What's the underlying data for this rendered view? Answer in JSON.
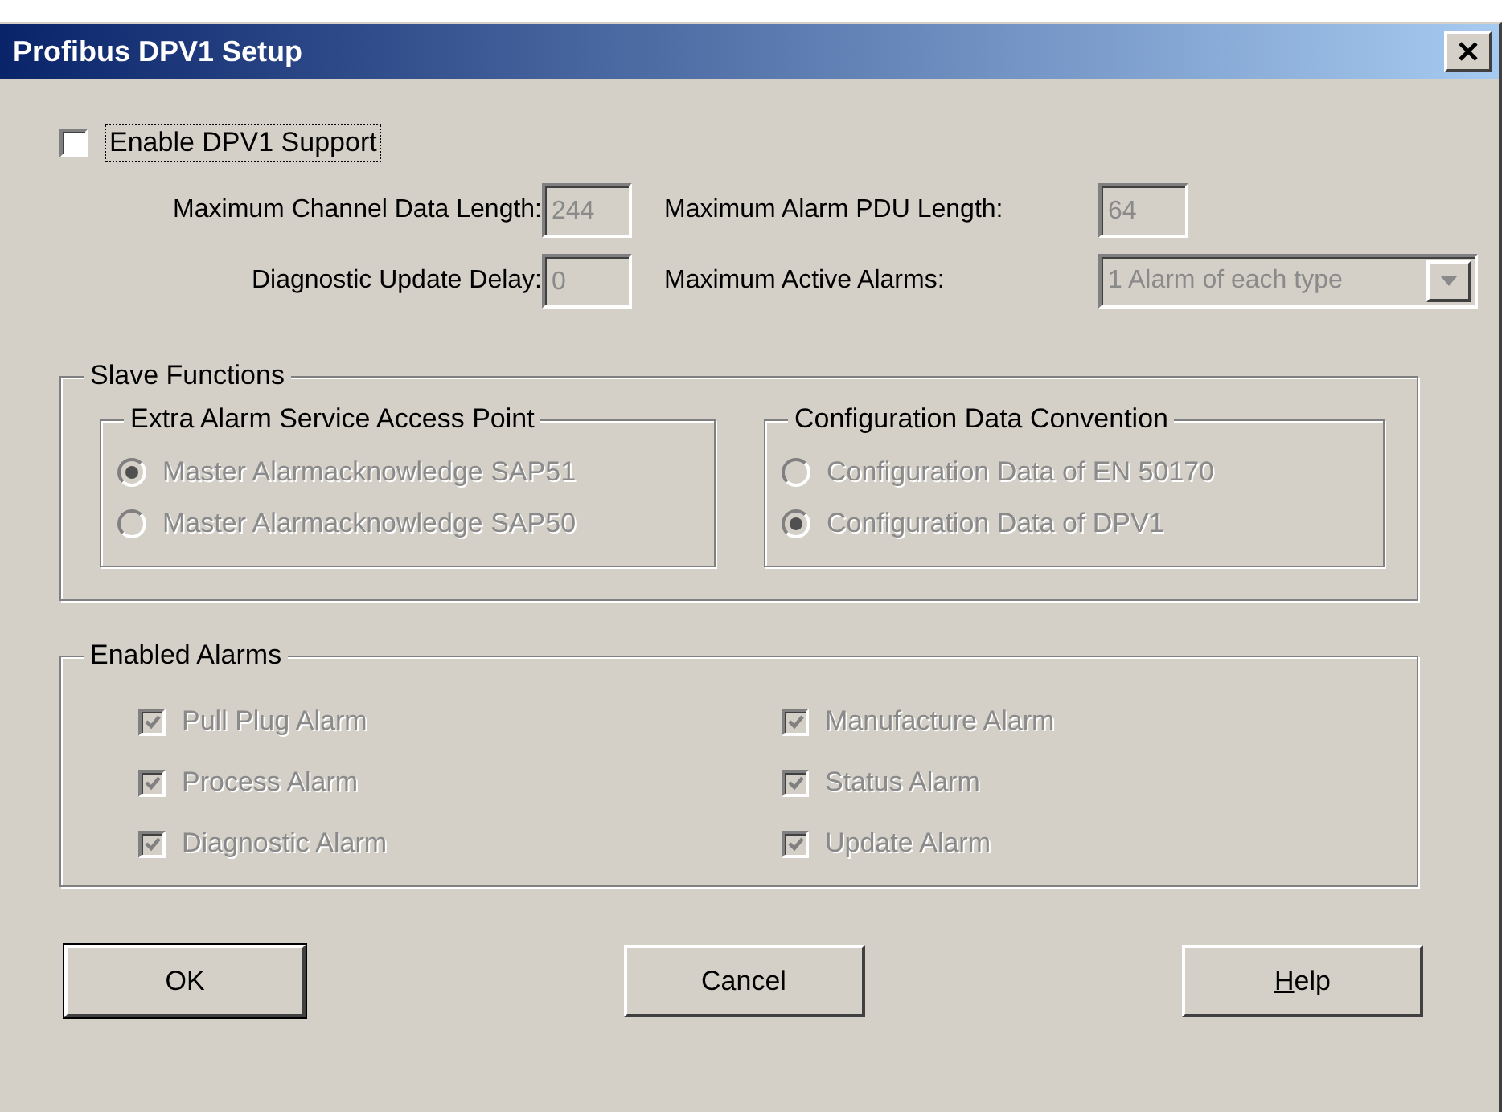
{
  "window": {
    "title": "Profibus DPV1 Setup"
  },
  "enable_checkbox": {
    "label": "Enable DPV1 Support",
    "checked": false
  },
  "fields": [
    {
      "label": "Maximum Channel Data Length:",
      "kind": "text",
      "value": "244",
      "disabled": true
    },
    {
      "label": "Maximum Alarm PDU Length:",
      "kind": "text",
      "value": "64",
      "disabled": true
    },
    {
      "label": "Diagnostic Update Delay:",
      "kind": "text",
      "value": "0",
      "disabled": true
    },
    {
      "label": "Maximum Active Alarms:",
      "kind": "dropdown",
      "value": "1 Alarm of each type",
      "disabled": true
    }
  ],
  "slave_functions": {
    "title": "Slave Functions",
    "groups": [
      {
        "title": "Extra Alarm Service Access Point",
        "options": [
          {
            "label": "Master Alarmacknowledge SAP51",
            "selected": true,
            "disabled": true
          },
          {
            "label": "Master Alarmacknowledge SAP50",
            "selected": false,
            "disabled": true
          }
        ]
      },
      {
        "title": "Configuration Data Convention",
        "options": [
          {
            "label": "Configuration Data of EN 50170",
            "selected": false,
            "disabled": true
          },
          {
            "label": "Configuration Data of DPV1",
            "selected": true,
            "disabled": true
          }
        ]
      }
    ]
  },
  "enabled_alarms": {
    "title": "Enabled Alarms",
    "items": [
      {
        "label": "Pull Plug Alarm",
        "checked": true,
        "disabled": true
      },
      {
        "label": "Manufacture Alarm",
        "checked": true,
        "disabled": true
      },
      {
        "label": "Process Alarm",
        "checked": true,
        "disabled": true
      },
      {
        "label": "Status Alarm",
        "checked": true,
        "disabled": true
      },
      {
        "label": "Diagnostic Alarm",
        "checked": true,
        "disabled": true
      },
      {
        "label": "Update Alarm",
        "checked": true,
        "disabled": true
      }
    ]
  },
  "buttons": [
    {
      "label": "OK",
      "default": true,
      "underline_first": false
    },
    {
      "label": "Cancel",
      "default": false,
      "underline_first": false
    },
    {
      "label": "Help",
      "default": false,
      "underline_first": true
    }
  ]
}
